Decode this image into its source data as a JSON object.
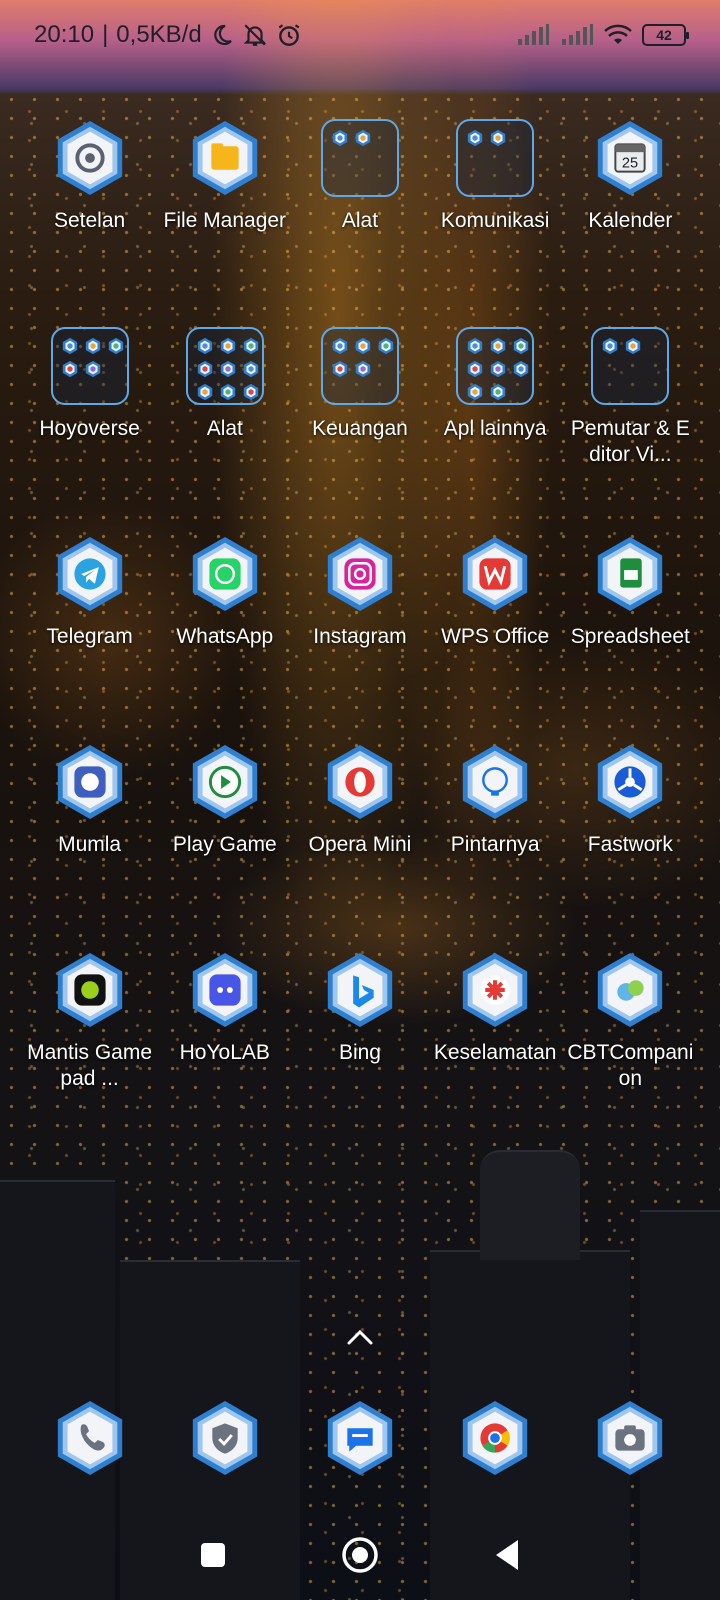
{
  "status_bar": {
    "time": "20:10",
    "separator": "|",
    "net_speed": "0,5KB/d",
    "battery": "42",
    "icons": [
      "moon-icon",
      "muted-bell-icon",
      "alarm-icon",
      "signal-1-icon",
      "signal-2-icon",
      "wifi-icon",
      "battery-icon"
    ]
  },
  "colors": {
    "hex_outer": "#2f7fd0",
    "hex_inner": "#f2f4f7",
    "folder_border": "#5fa8e8",
    "status_text": "#1f1f2a"
  },
  "home": {
    "rows": [
      [
        {
          "label": "Setelan",
          "type": "app",
          "icon": "settings-gear-icon"
        },
        {
          "label": "File Manager",
          "type": "app",
          "icon": "folder-yellow-icon"
        },
        {
          "label": "Alat",
          "type": "folder",
          "count": 2
        },
        {
          "label": "Komunikasi",
          "type": "folder",
          "count": 2
        },
        {
          "label": "Kalender",
          "type": "app",
          "icon": "calendar-icon",
          "badge": "25"
        }
      ],
      [
        {
          "label": "Hoyoverse",
          "type": "folder",
          "count": 5
        },
        {
          "label": "Alat",
          "type": "folder",
          "count": 9
        },
        {
          "label": "Keuangan",
          "type": "folder",
          "count": 5
        },
        {
          "label": "Apl lainnya",
          "type": "folder",
          "count": 8
        },
        {
          "label": "Pemutar & Editor Vi...",
          "type": "folder",
          "count": 2
        }
      ],
      [
        {
          "label": "Telegram",
          "type": "app",
          "icon": "telegram-icon"
        },
        {
          "label": "WhatsApp",
          "type": "app",
          "icon": "whatsapp-icon"
        },
        {
          "label": "Instagram",
          "type": "app",
          "icon": "instagram-icon"
        },
        {
          "label": "WPS Office",
          "type": "app",
          "icon": "wps-office-icon"
        },
        {
          "label": "Spreadsheet",
          "type": "app",
          "icon": "spreadsheet-icon"
        }
      ],
      [
        {
          "label": "Mumla",
          "type": "app",
          "icon": "mumla-icon"
        },
        {
          "label": "Play Game",
          "type": "app",
          "icon": "play-game-icon"
        },
        {
          "label": "Opera Mini",
          "type": "app",
          "icon": "opera-mini-icon"
        },
        {
          "label": "Pintarnya",
          "type": "app",
          "icon": "pintarnya-icon"
        },
        {
          "label": "Fastwork",
          "type": "app",
          "icon": "fastwork-icon"
        }
      ],
      [
        {
          "label": "Mantis Gamepad ...",
          "type": "app",
          "icon": "mantis-gamepad-icon"
        },
        {
          "label": "HoYoLAB",
          "type": "app",
          "icon": "hoyolab-icon"
        },
        {
          "label": "Bing",
          "type": "app",
          "icon": "bing-icon"
        },
        {
          "label": "Keselamatan",
          "type": "app",
          "icon": "safety-icon"
        },
        {
          "label": "CBTCompanion",
          "type": "app",
          "icon": "cbt-companion-icon"
        }
      ]
    ]
  },
  "dock": [
    {
      "icon": "phone-icon"
    },
    {
      "icon": "security-shield-icon"
    },
    {
      "icon": "messages-icon"
    },
    {
      "icon": "chrome-icon"
    },
    {
      "icon": "camera-icon"
    }
  ],
  "navbar": [
    "recents-button",
    "home-button",
    "back-button"
  ]
}
